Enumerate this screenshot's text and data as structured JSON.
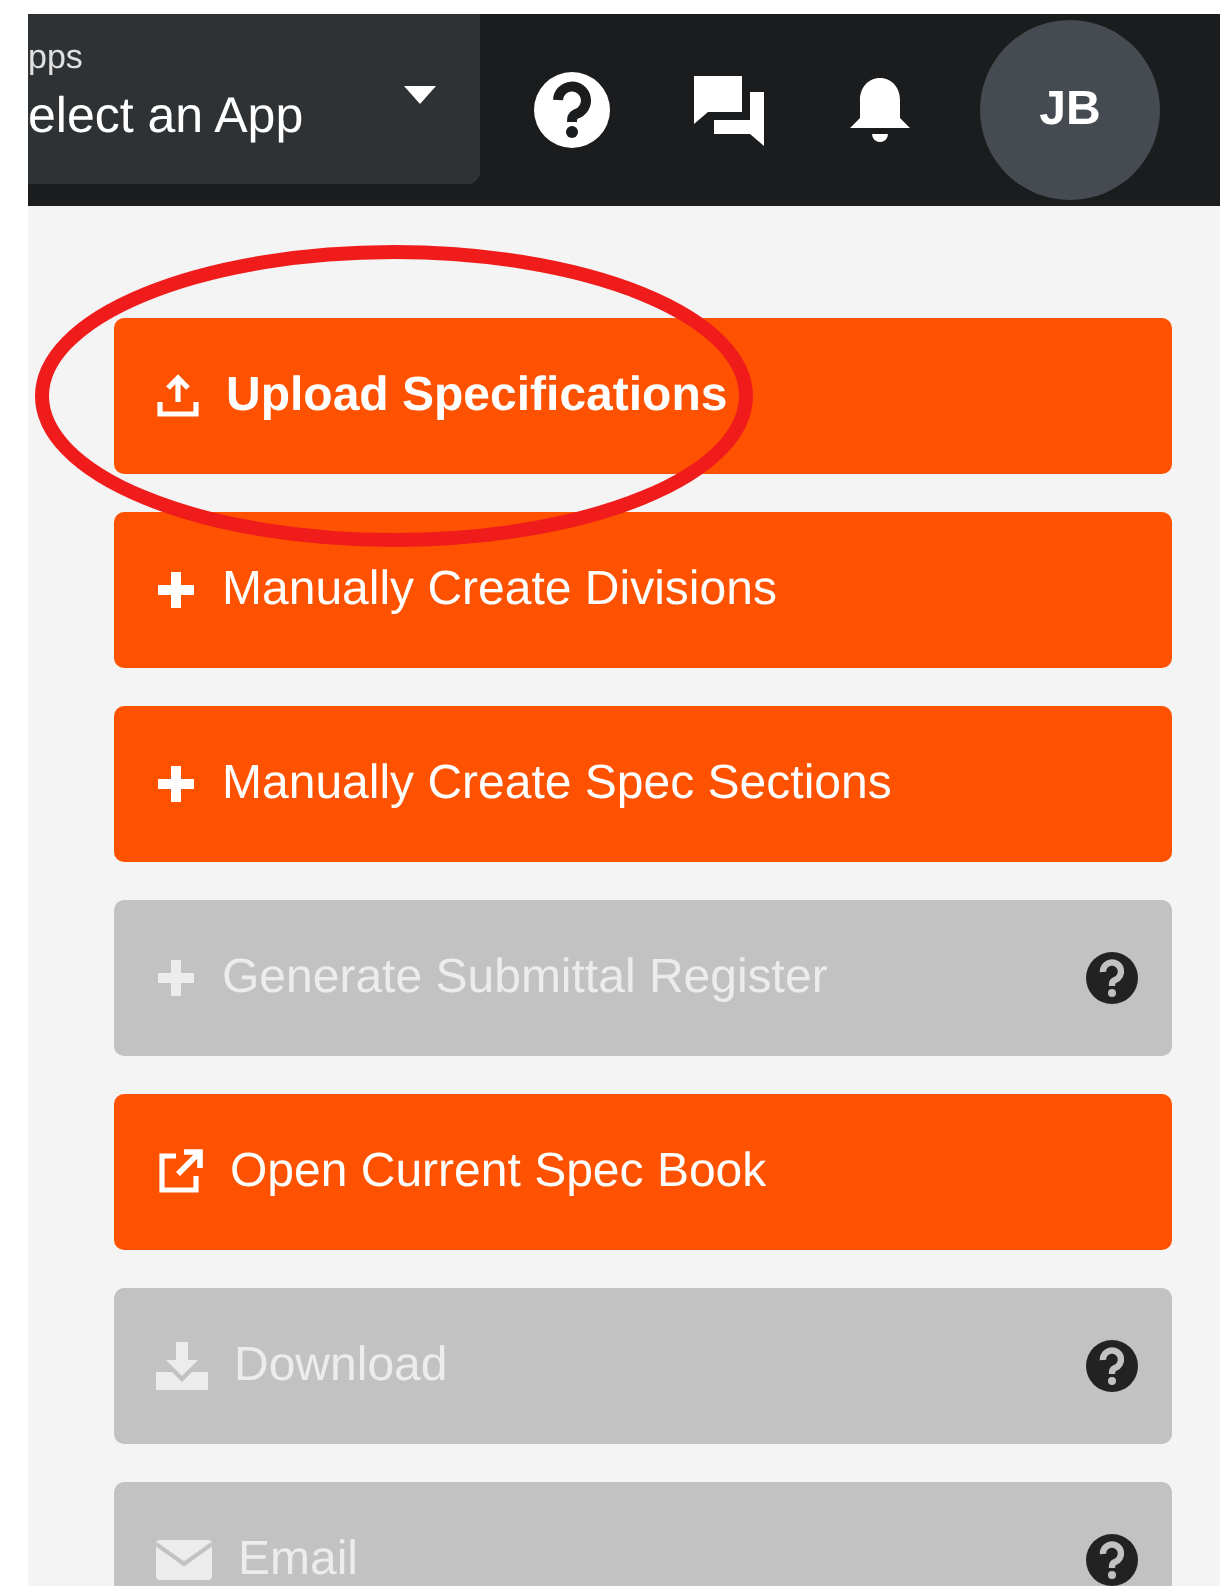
{
  "header": {
    "app_select": {
      "label": "pps",
      "value": "elect an App"
    },
    "avatar": "JB"
  },
  "actions": [
    {
      "label": "Upload Specifications",
      "kind": "upload",
      "disabled": false,
      "help": false,
      "emphasized": true
    },
    {
      "label": "Manually Create Divisions",
      "kind": "create",
      "disabled": false,
      "help": false,
      "emphasized": false
    },
    {
      "label": "Manually Create Spec Sections",
      "kind": "create",
      "disabled": false,
      "help": false,
      "emphasized": false
    },
    {
      "label": "Generate Submittal Register",
      "kind": "create",
      "disabled": true,
      "help": true,
      "emphasized": false
    },
    {
      "label": "Open Current Spec Book",
      "kind": "open",
      "disabled": false,
      "help": false,
      "emphasized": false
    },
    {
      "label": "Download",
      "kind": "download",
      "disabled": true,
      "help": true,
      "emphasized": false
    },
    {
      "label": "Email",
      "kind": "email",
      "disabled": true,
      "help": true,
      "emphasized": false
    }
  ],
  "annotation": {
    "kind": "ellipse",
    "color": "#f01c1c"
  }
}
